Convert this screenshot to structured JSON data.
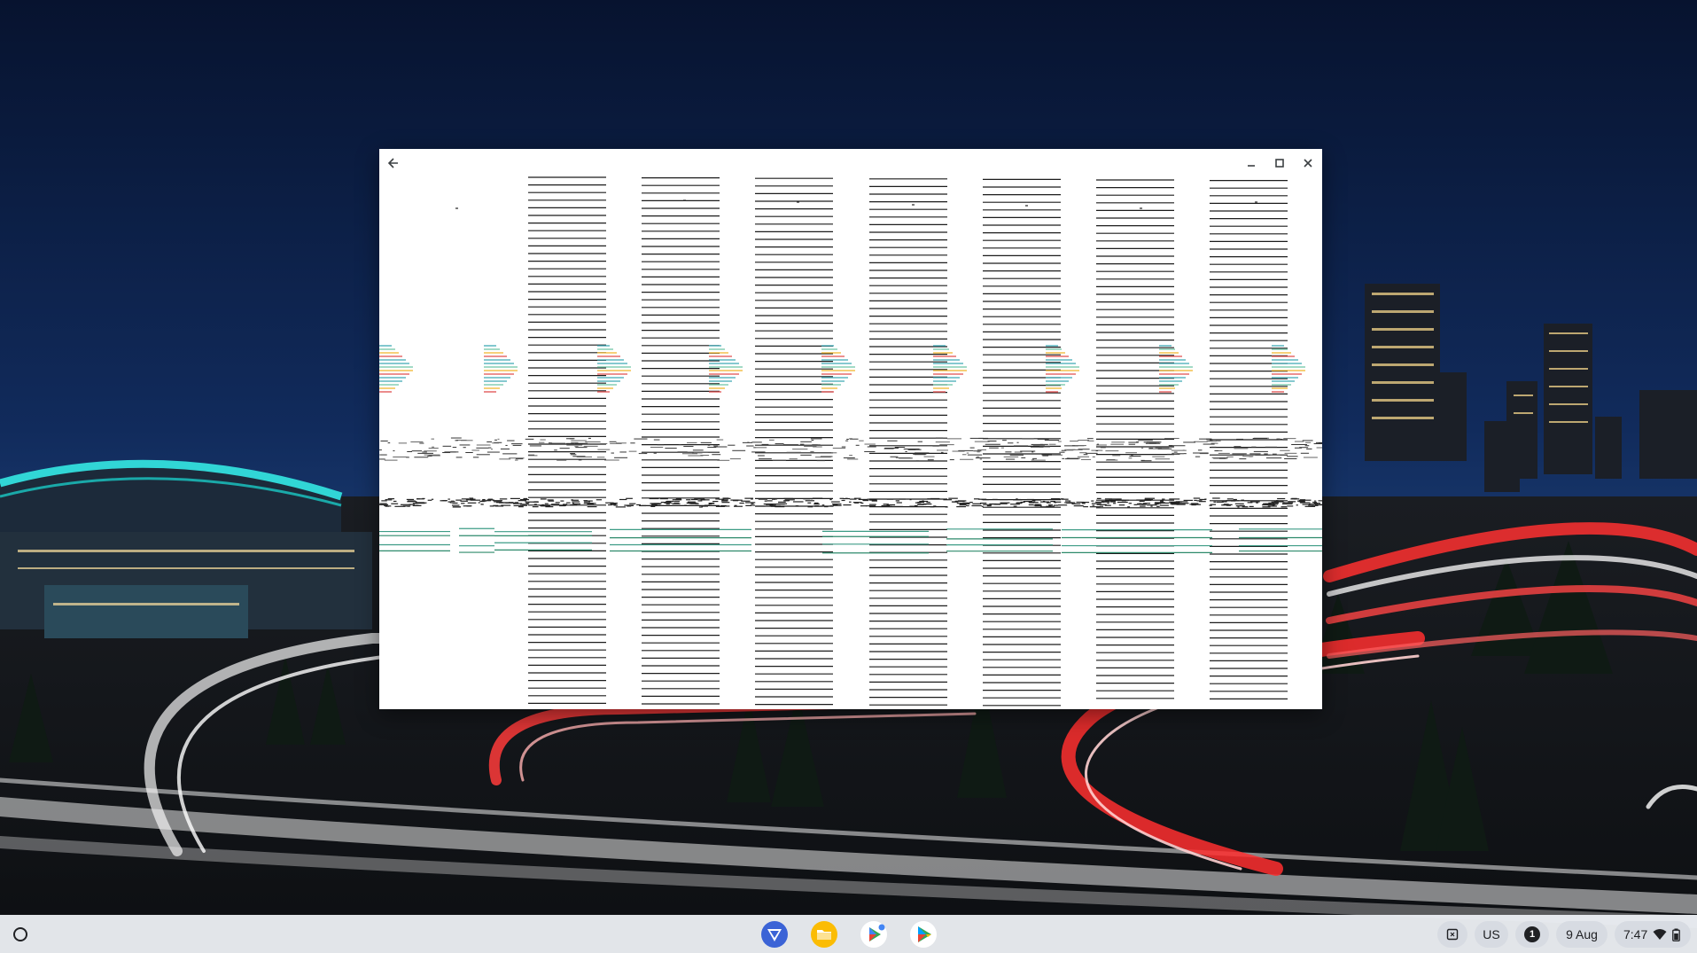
{
  "desktop": {
    "wallpaper_icon": "seattle-night-highway-wallpaper"
  },
  "window": {
    "back_icon": "arrow-left-icon",
    "minimize_icon": "minimize-icon",
    "maximize_icon": "maximize-icon",
    "close_icon": "close-icon",
    "content_state": "rendering-glitch"
  },
  "shelf": {
    "launcher_icon": "launcher-circle-icon",
    "apps": [
      {
        "name": "tail-app",
        "icon": "blue-triangle-logo-icon"
      },
      {
        "name": "files",
        "icon": "folder-icon"
      },
      {
        "name": "play-games",
        "icon": "play-games-icon"
      },
      {
        "name": "play-store",
        "icon": "play-store-icon"
      }
    ],
    "tray": {
      "screen_capture_icon": "screen-capture-icon",
      "keyboard_layout": "US",
      "notification_count": "1",
      "date": "9 Aug",
      "time": "7:47",
      "wifi_icon": "wifi-icon",
      "battery_icon": "battery-icon"
    }
  },
  "colors": {
    "sky_top": "#08163a",
    "sky_bottom": "#17356b",
    "stadium_arch": "#31d6d6",
    "tail_red": "#ff3b3b",
    "tail_white": "#f2f2f2",
    "shelf_bg": "#ebeef2",
    "tray_pill": "#d7dbe2"
  }
}
